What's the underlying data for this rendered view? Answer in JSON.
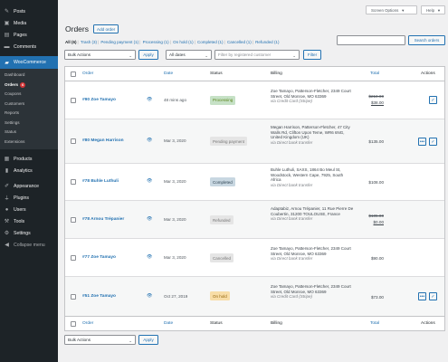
{
  "sidebar": {
    "items_top": [
      {
        "label": "Posts",
        "icon": "pin-icon"
      },
      {
        "label": "Media",
        "icon": "media-icon"
      },
      {
        "label": "Pages",
        "icon": "page-icon"
      },
      {
        "label": "Comments",
        "icon": "comment-icon"
      }
    ],
    "woocommerce_label": "WooCommerce",
    "submenu": [
      "Dashboard",
      "Orders",
      "Coupons",
      "Customers",
      "Reports",
      "Settings",
      "Status",
      "Extensions"
    ],
    "orders_badge": "6",
    "items_bottom": [
      {
        "label": "Products",
        "icon": "products-icon"
      },
      {
        "label": "Analytics",
        "icon": "analytics-icon"
      },
      {
        "label": "Appearance",
        "icon": "brush-icon"
      },
      {
        "label": "Plugins",
        "icon": "plugin-icon"
      },
      {
        "label": "Users",
        "icon": "user-icon"
      },
      {
        "label": "Tools",
        "icon": "wrench-icon"
      },
      {
        "label": "Settings",
        "icon": "settings-icon"
      },
      {
        "label": "Collapse menu",
        "icon": "collapse-icon"
      }
    ]
  },
  "header": {
    "screen_options": "Screen Options",
    "help": "Help",
    "title": "Orders",
    "add_order": "Add order"
  },
  "filters": {
    "all": "All (6)",
    "trash": "Trash (3)",
    "pending": "Pending payment (1)",
    "processing": "Processing (1)",
    "onhold": "On hold (1)",
    "completed": "Completed (1)",
    "cancelled": "Cancelled (1)",
    "refunded": "Refunded (1)",
    "sep": "|"
  },
  "search": {
    "button": "Search orders"
  },
  "toolbar": {
    "bulk_actions": "Bulk Actions",
    "apply": "Apply",
    "all_dates": "All dates",
    "customer_placeholder": "Filter by registered customer",
    "filter": "Filter"
  },
  "columns": {
    "order": "Order",
    "date": "Date",
    "status": "Status",
    "billing": "Billing",
    "total": "Total",
    "actions": "Actions"
  },
  "orders": [
    {
      "number": "#90 Zoe Tamayo",
      "date": "48 mins ago",
      "status": "Processing",
      "status_color": "#c6e1c6",
      "status_text_color": "#5b841b",
      "billing": "Zoe Tamayo, Patterson-Fletcher, 2349 Court Street, Old Monroe, MO 63369",
      "via": "via Credit Card (Stripe)",
      "total_old": "$218.00",
      "total": "$38.00"
    },
    {
      "number": "#80 Megan Harrison",
      "date": "Mar 3, 2020",
      "status": "Pending payment",
      "status_color": "#e5e5e5",
      "status_text_color": "#777777",
      "billing": "Megan Harrison, Patterson-Fletcher, 47 City Walls Rd, Clifton Upon Teme, WR6 6NG, United Kingdom (UK)",
      "via": "via Direct bank transfer",
      "total_old": "",
      "total": "$135.00"
    },
    {
      "number": "#78 Buhle Luthuli",
      "date": "Mar 3, 2020",
      "status": "Completed",
      "status_color": "#c8d7e1",
      "status_text_color": "#2e4453",
      "billing": "Buhle Luthuli, SAXS, 1864 Bo Meul St, Woodstock, Western Cape, 7925, South Africa",
      "via": "via Direct bank transfer",
      "total_old": "",
      "total": "$108.00"
    },
    {
      "number": "#78 Arnou Trépanier",
      "date": "Mar 3, 2020",
      "status": "Refunded",
      "status_color": "#e5e5e5",
      "status_text_color": "#777777",
      "billing": "Adaptabiz, Arnou Trépanier, 11 Rue Pierre De Coubertin, 31200 TOULOUSE, France",
      "via": "via Direct bank transfer",
      "total_old": "$105.00",
      "total": "$0.00"
    },
    {
      "number": "#77 Zoe Tamayo",
      "date": "Mar 3, 2020",
      "status": "Cancelled",
      "status_color": "#e5e5e5",
      "status_text_color": "#777777",
      "billing": "Zoe Tamayo, Patterson-Fletcher, 2349 Court Street, Old Monroe, MO 63369",
      "via": "via Direct bank transfer",
      "total_old": "",
      "total": "$90.00"
    },
    {
      "number": "#51 Zoe Tamayo",
      "date": "Oct 27, 2019",
      "status": "On hold",
      "status_color": "#f8dda7",
      "status_text_color": "#94660c",
      "billing": "Zoe Tamayo, Patterson-Fletcher, 2349 Court Street, Old Monroe, MO 63369",
      "via": "via Credit Card (Stripe)",
      "total_old": "",
      "total": "$73.00"
    }
  ],
  "colors": {
    "accent": "#2271b1",
    "sidebar_bg": "#1d2327",
    "current_menu": "#2271b1"
  }
}
